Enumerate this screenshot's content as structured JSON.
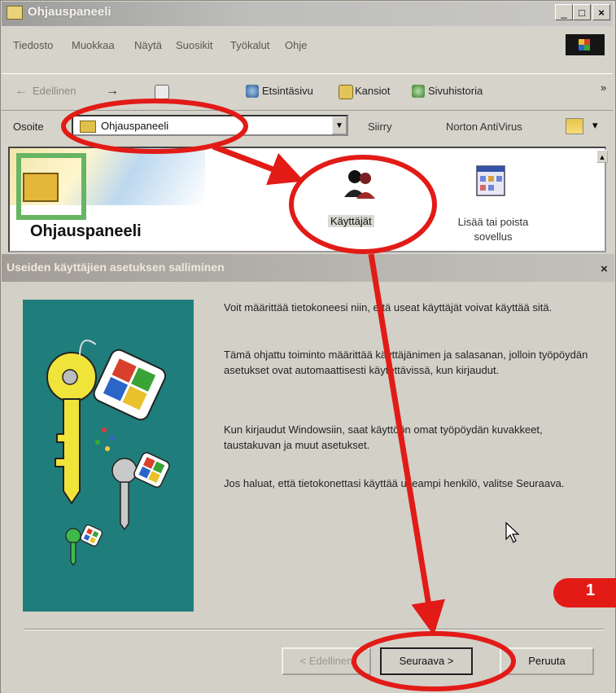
{
  "window": {
    "title": "Ohjauspaneeli",
    "min_glyph": "_",
    "max_glyph": "□",
    "close_glyph": "×"
  },
  "menu": [
    "Tiedosto",
    "Muokkaa",
    "Näytä",
    "Suosikit",
    "Työkalut",
    "Ohje"
  ],
  "toolbar": {
    "back": "Edellinen",
    "back_glyph": "←",
    "forward_glyph": "→",
    "search": "Etsintäsivu",
    "folders": "Kansiot",
    "history": "Sivuhistoria",
    "more": "»"
  },
  "address": {
    "label": "Osoite",
    "value": "Ohjauspaneeli",
    "go": "Siirry",
    "norton": "Norton AntiVirus",
    "drop_glyph": "▼"
  },
  "control_panel": {
    "title": "Ohjauspaneeli",
    "items": [
      {
        "label": "Käyttäjät",
        "icon": "users-icon"
      },
      {
        "label": "Lisää tai poista sovellus",
        "icon": "add-remove-programs-icon"
      }
    ]
  },
  "wizard": {
    "title": "Useiden käyttäjien asetuksen salliminen",
    "close_glyph": "×",
    "paragraphs": [
      "Voit määrittää tietokoneesi niin, että useat käyttäjät voivat käyttää sitä.",
      "Tämä ohjattu toiminto määrittää käyttäjänimen ja salasanan, jolloin työpöydän asetukset ovat automaattisesti käytettävissä, kun kirjaudut.",
      "Kun kirjaudut Windowsiin, saat käyttöön omat työpöydän kuvakkeet, taustakuvan ja muut asetukset.",
      "Jos haluat, että tietokonettasi käyttää useampi henkilö, valitse Seuraava."
    ],
    "buttons": {
      "back": "< Edellinen",
      "next": "Seuraava >",
      "cancel": "Peruuta"
    }
  },
  "annotation": {
    "step_number": "1",
    "color": "#e21b17"
  }
}
